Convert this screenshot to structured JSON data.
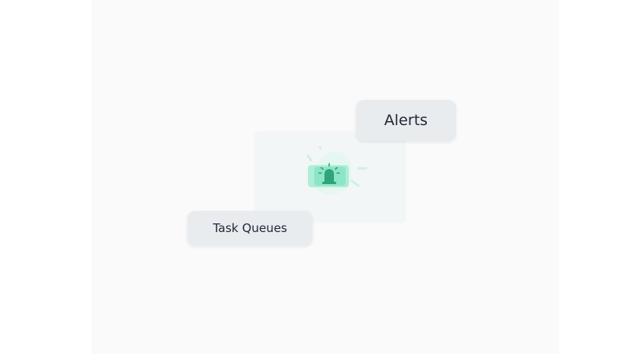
{
  "pills": {
    "alerts_label": "Alerts",
    "task_queues_label": "Task Queues"
  },
  "icon": {
    "name": "bell-icon",
    "color": "#2fa37a",
    "glow_color": "#7fe3c1"
  },
  "colors": {
    "background": "#ffffff",
    "panel": "#fafafa",
    "card": "#f3f6f6",
    "pill": "#e9ecef",
    "text": "#1f2733"
  }
}
